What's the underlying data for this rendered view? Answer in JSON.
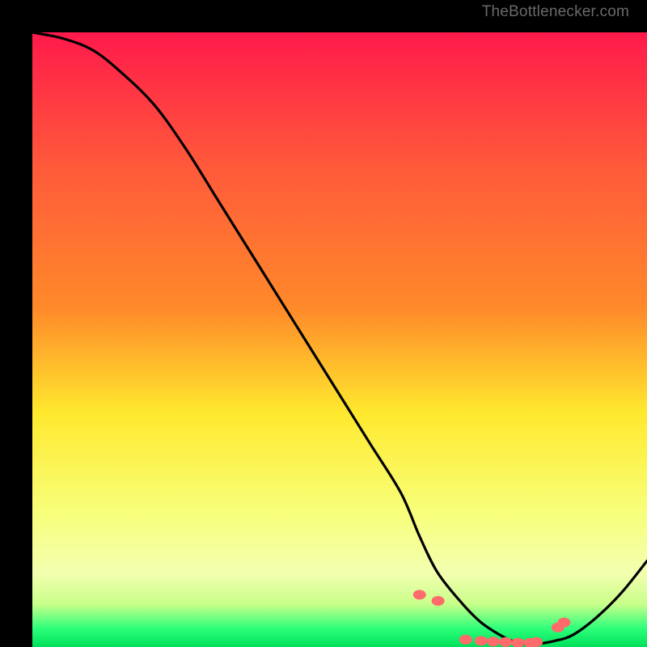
{
  "watermark": "TheBottlenecker.com",
  "chart_data": {
    "type": "line",
    "title": "",
    "xlabel": "",
    "ylabel": "",
    "xlim": [
      0,
      100
    ],
    "ylim": [
      0,
      100
    ],
    "x": [
      0,
      5,
      10,
      15,
      20,
      25,
      30,
      35,
      40,
      45,
      50,
      55,
      60,
      63,
      66,
      70,
      73,
      76,
      78,
      80,
      82,
      85,
      88,
      92,
      96,
      100
    ],
    "y": [
      100,
      99,
      97,
      93,
      88,
      81,
      73,
      65,
      57,
      49,
      41,
      33,
      25,
      18,
      12,
      7,
      4,
      2,
      1,
      0.5,
      0.5,
      1,
      2,
      5,
      9,
      14
    ],
    "tick_dots": {
      "x": [
        63,
        66,
        70.5,
        73,
        75,
        77,
        79,
        81,
        82,
        85.5,
        86.5
      ],
      "y": [
        8.5,
        7.5,
        1.2,
        1.0,
        0.9,
        0.8,
        0.7,
        0.7,
        0.8,
        3.2,
        4.0
      ]
    },
    "gradient_colors": {
      "top": "#ff1a4b",
      "mid_upper": "#ff8a2a",
      "mid": "#ffe92e",
      "mid_lower": "#f8ff7a",
      "green_start": "#c9ff8a",
      "green": "#2dff7a",
      "bottom": "#00e05a"
    },
    "curve_color": "#000000",
    "dot_color": "#ff6a6a"
  }
}
